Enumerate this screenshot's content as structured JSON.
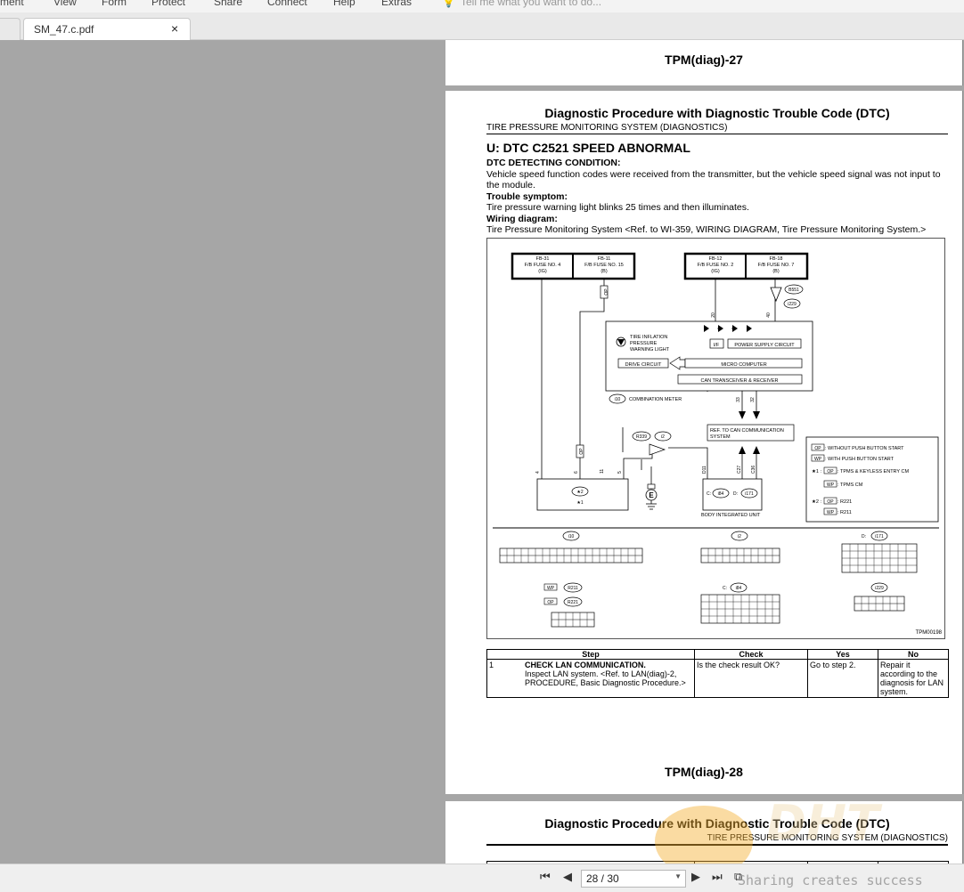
{
  "menu": [
    "ment",
    "View",
    "Form",
    "Protect",
    "Share",
    "Connect",
    "Help",
    "Extras"
  ],
  "menu_search_placeholder": "Tell me what you want to do...",
  "tab": {
    "title": "SM_47.c.pdf",
    "close": "×"
  },
  "page27": {
    "title": "TPM(diag)-27"
  },
  "page28": {
    "heading": "Diagnostic Procedure with Diagnostic Trouble Code (DTC)",
    "subheading": "TIRE PRESSURE MONITORING SYSTEM (DIAGNOSTICS)",
    "dtc_title": "U:  DTC C2521 SPEED ABNORMAL",
    "detecting_label": "DTC DETECTING CONDITION:",
    "detecting_text": "Vehicle speed function codes were received from the transmitter, but the vehicle speed signal was not input to the module.",
    "symptom_label": "Trouble symptom:",
    "symptom_text": "Tire pressure warning light blinks 25 times and then illuminates.",
    "wiring_label": "Wiring diagram:",
    "wiring_text": "Tire Pressure Monitoring System <Ref. to WI-359, WIRING DIAGRAM, Tire Pressure Monitoring System.>",
    "footer_title": "TPM(diag)-28"
  },
  "diagram": {
    "fb31": "FB-31",
    "fb31_sub": "F/B FUSE NO. 4",
    "fb31_ig": "(IG)",
    "fb11": "FB-11",
    "fb11_sub": "F/B FUSE NO. 15",
    "fb11_b": "(B)",
    "fb12": "FB-12",
    "fb12_sub": "F/B FUSE NO. 2",
    "fb12_ig": "(IG)",
    "fb18": "FB-18",
    "fb18_sub": "F/B FUSE NO. 7",
    "fb18_b": "(B)",
    "op": "OP",
    "wp": "WP",
    "b551": "B551",
    "i229": "i229",
    "n20": "20",
    "n40": "40",
    "tire1": "TIRE INFLATION",
    "tire2": "PRESSURE",
    "tire3": "WARNING LIGHT",
    "if": "I/F",
    "power": "POWER SUPPLY CIRCUIT",
    "drive": "DRIVE CIRCUIT",
    "micro": "MICRO COMPUTER",
    "can": "CAN TRANSCEIVER & RECEIVER",
    "i10": "i10",
    "combo": "COMBINATION METER",
    "n33": "33",
    "n32": "32",
    "ref1": "REF. TO CAN COMMUNICATION",
    "ref2": "SYSTEM",
    "r339": "R339",
    "i2": "i2",
    "n4": "4",
    "n6": "6",
    "n11": "11",
    "n5": "5",
    "d11": "D11",
    "c27": "C27",
    "c36": "C36",
    "star2": "★2",
    "star1": "★1",
    "e": "E",
    "c": "C:",
    "i84": "i84",
    "d": "D:",
    "i171": "i171",
    "biu": "BODY INTEGRATED UNIT",
    "leg_op": ": WITHOUT PUSH BUTTON START",
    "leg_wp": ": WITH PUSH BUTTON START",
    "leg_s1": "★1 :",
    "leg_s1a": ": TPMS & KEYLESS ENTRY CM",
    "leg_s1b": ": TPMS CM",
    "leg_s2": "★2 :",
    "leg_s2a": ": R221",
    "leg_s2b": ": R211",
    "con_i10": "i10",
    "con_i2": "i2",
    "con_d": "D:",
    "con_i171": "i171",
    "con_r211": "R211",
    "con_r221": "R221",
    "con_c": "C:",
    "con_i84": "i84",
    "con_i229": "i229",
    "code": "TPM00198"
  },
  "table": {
    "headers": [
      "Step",
      "Check",
      "Yes",
      "No"
    ],
    "row1": {
      "num": "1",
      "step_title": "CHECK LAN COMMUNICATION.",
      "step_text": "Inspect LAN system. <Ref. to LAN(diag)-2, PROCEDURE, Basic Diagnostic Procedure.>",
      "check": "Is the check result OK?",
      "yes": "Go to step 2.",
      "no": "Repair it according to the diagnosis for LAN system."
    }
  },
  "page29": {
    "heading": "Diagnostic Procedure with Diagnostic Trouble Code (DTC)",
    "subheading": "TIRE PRESSURE MONITORING SYSTEM (DIAGNOSTICS)"
  },
  "pager": {
    "value": "28 / 30"
  },
  "watermark": {
    "text": "Sharing creates success",
    "logo": "DHT"
  }
}
